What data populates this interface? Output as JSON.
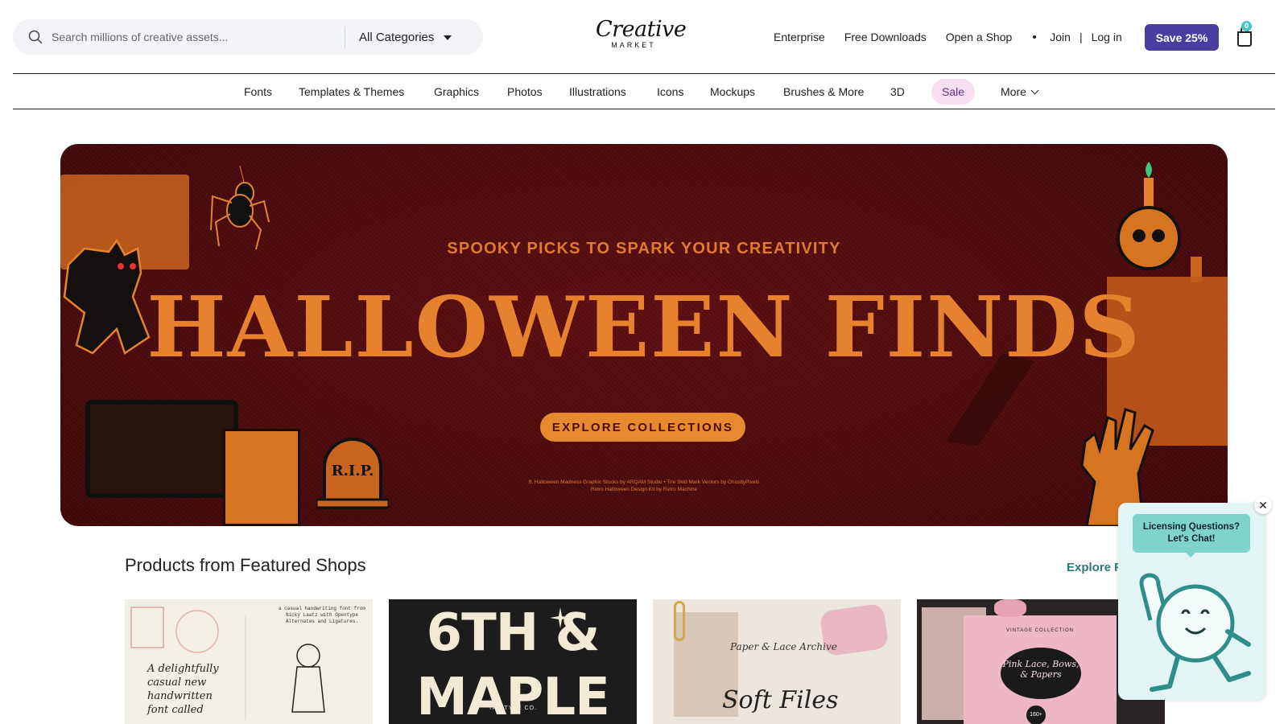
{
  "header": {
    "search_placeholder": "Search millions of creative assets...",
    "category_select": "All Categories",
    "logo_word": "Creative",
    "logo_sub": "MARKET",
    "links": {
      "enterprise": "Enterprise",
      "free_downloads": "Free Downloads",
      "open_shop": "Open a Shop",
      "join": "Join",
      "separator": "|",
      "login": "Log in"
    },
    "save_button": "Save 25%",
    "cart_count": "0"
  },
  "category_nav": {
    "items": [
      "Fonts",
      "Templates & Themes",
      "Graphics",
      "Photos",
      "Illustrations",
      "Icons",
      "Mockups",
      "Brushes & More",
      "3D",
      "Sale",
      "More"
    ]
  },
  "hero": {
    "kicker": "SPOOKY PICKS TO SPARK YOUR CREATIVITY",
    "title": "HALLOWEEN FINDS",
    "cta": "EXPLORE COLLECTIONS",
    "credit_line1": "ft. Halloween Madness Graphic Stocks by ARQAM Studio • Tire Skid Mark Vectors by GhostlyPixels",
    "credit_line2": "Retro Halloween Design Kit by Retro Machine",
    "colors": {
      "background": "#4c0a0c",
      "accent": "#e6822e"
    }
  },
  "featured": {
    "title": "Products from Featured Shops",
    "explore_link": "Explore F",
    "cards": [
      {
        "label": "A delightfully casual new handwritten font called",
        "subtitle": "a casual handwriting font from Nicky Laatz with Opentype Alternates and Ligatures."
      },
      {
        "label": "6TH & MAPLE",
        "subtitle": "TAN TYPE CO."
      },
      {
        "label": "Soft Files",
        "subtitle": "Paper & Lace Archive"
      },
      {
        "label": "Pink Lace, Bows, & Papers",
        "subtitle": "VINTAGE COLLECTION",
        "badge": "160+"
      }
    ]
  },
  "chat": {
    "bubble_line1": "Licensing Questions?",
    "bubble_line2": "Let's Chat!",
    "close_symbol": "✕"
  }
}
